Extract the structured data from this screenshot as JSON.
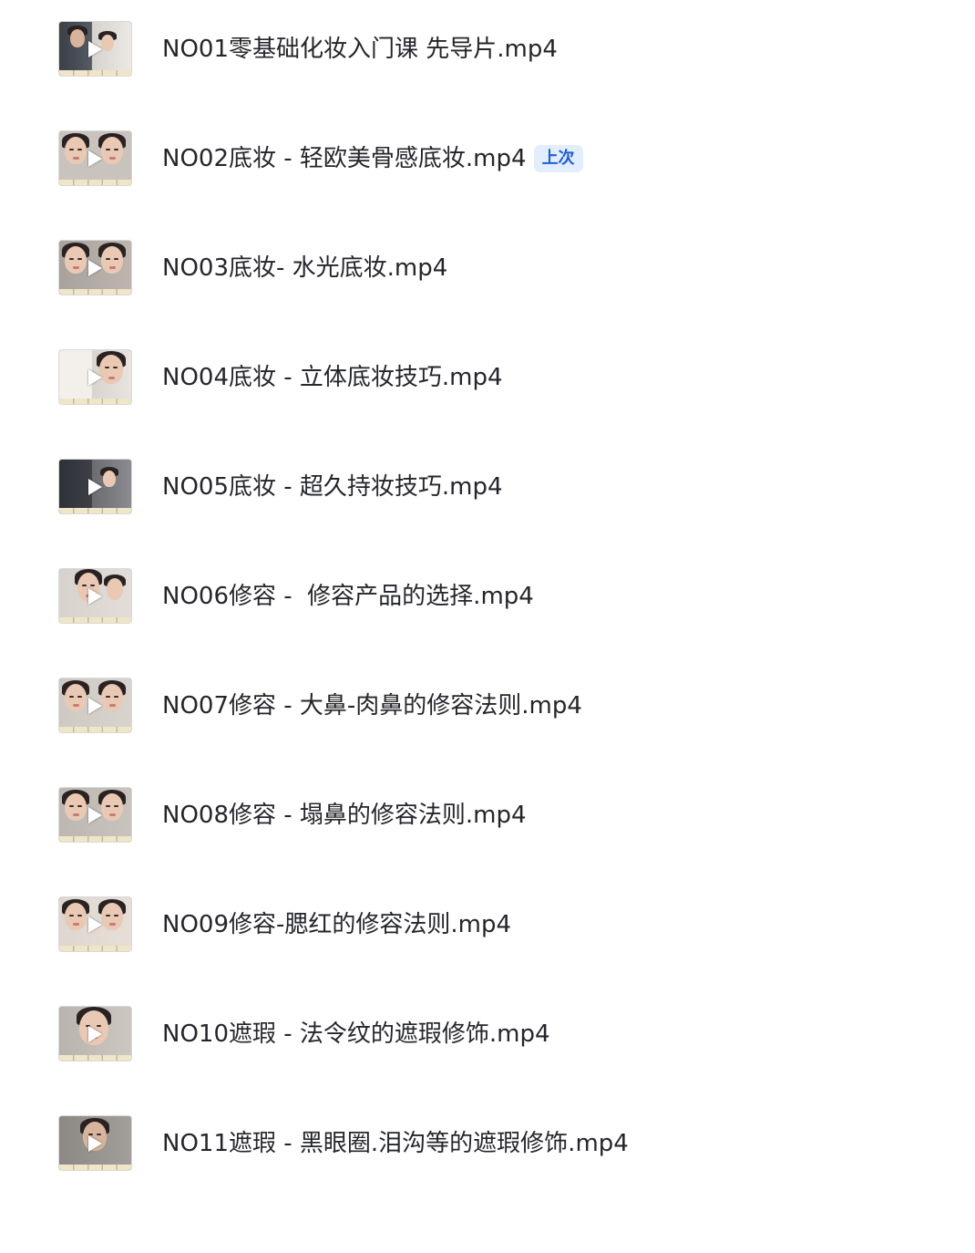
{
  "files": [
    {
      "name": "NO01零基础化妆入门课 先导片.mp4",
      "thumbnail": "play-icon"
    },
    {
      "name": "NO02底妆 - 轻欧美骨感底妆.mp4",
      "thumbnail": "play-icon",
      "badge": "上次"
    },
    {
      "name": "NO03底妆- 水光底妆.mp4",
      "thumbnail": "play-icon"
    },
    {
      "name": "NO04底妆 - 立体底妆技巧.mp4",
      "thumbnail": "play-icon"
    },
    {
      "name": "NO05底妆 - 超久持妆技巧.mp4",
      "thumbnail": "play-icon"
    },
    {
      "name": "NO06修容 -  修容产品的选择.mp4",
      "thumbnail": "play-icon"
    },
    {
      "name": "NO07修容 - 大鼻-肉鼻的修容法则.mp4",
      "thumbnail": "play-icon"
    },
    {
      "name": "NO08修容 - 塌鼻的修容法则.mp4",
      "thumbnail": "play-icon"
    },
    {
      "name": "NO09修容-腮红的修容法则.mp4",
      "thumbnail": "play-icon"
    },
    {
      "name": "NO10遮瑕 - 法令纹的遮瑕修饰.mp4",
      "thumbnail": "play-icon"
    },
    {
      "name": "NO11遮瑕 - 黑眼圈.泪沟等的遮瑕修饰.mp4",
      "thumbnail": "play-icon"
    }
  ],
  "colors": {
    "text": "#25262b",
    "badge_bg": "#e2eefe",
    "badge_text": "#1f5fd6"
  }
}
